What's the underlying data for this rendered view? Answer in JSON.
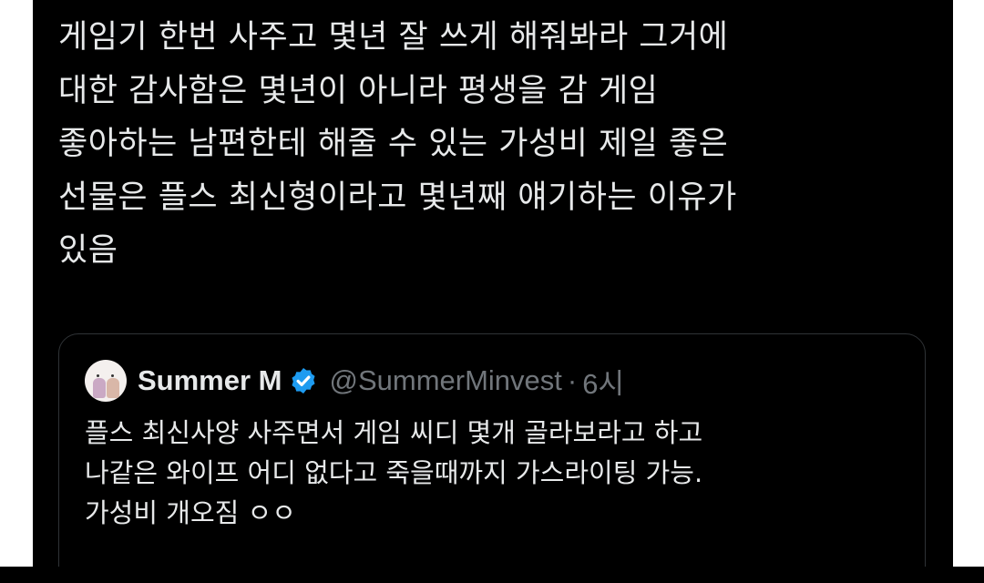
{
  "tweet": {
    "lines": [
      "게임기 한번 사주고 몇년 잘 쓰게 해줘봐라 그거에",
      "대한 감사함은 몇년이 아니라 평생을 감 게임",
      "좋아하는 남편한테 해줄 수 있는 가성비 제일 좋은",
      "선물은 플스 최신형이라고 몇년째 얘기하는 이유가",
      "있음"
    ]
  },
  "quote": {
    "display_name": "Summer M",
    "handle": "@SummerMinvest",
    "separator": "·",
    "time": "6시",
    "verified_icon": "verified-badge-icon",
    "lines": [
      "플스 최신사양 사주면서 게임 씨디 몇개 골라보라고 하고",
      "나같은 와이프 어디 없다고 죽을때까지 가스라이팅 가능.",
      "가성비 개오짐 ㅇㅇ"
    ]
  },
  "colors": {
    "background": "#000000",
    "text": "#e7e9ea",
    "secondary_text": "#71767b",
    "border": "#2f3336",
    "verified_blue": "#1d9bf0"
  }
}
